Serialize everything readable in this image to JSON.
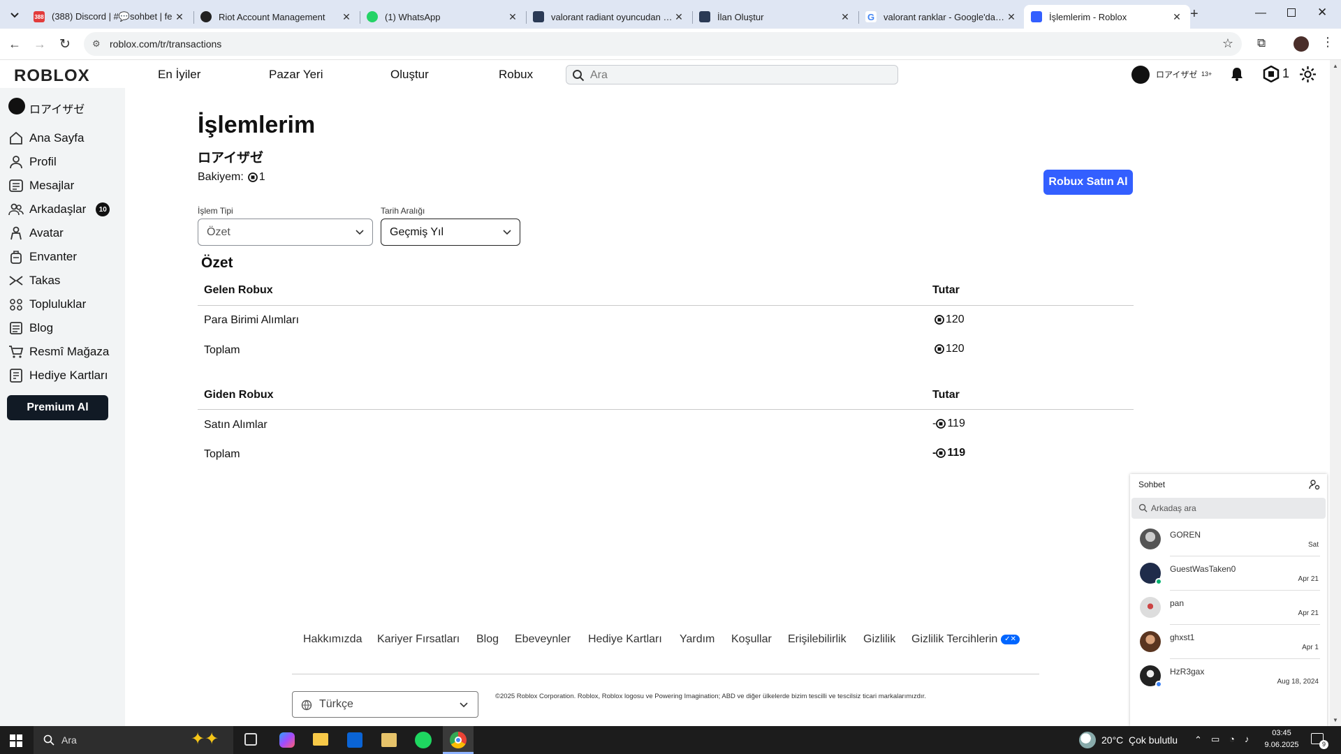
{
  "browser": {
    "tabs": [
      {
        "title": "(388) Discord | #💬sohbet | fe",
        "icon": "discord-icon",
        "badge": "388"
      },
      {
        "title": "Riot Account Management",
        "icon": "riot-icon"
      },
      {
        "title": "(1) WhatsApp",
        "icon": "whatsapp-icon"
      },
      {
        "title": "valorant radiant oyuncudan bo",
        "icon": "roblox-icon"
      },
      {
        "title": "İlan Oluştur",
        "icon": "roblox-icon"
      },
      {
        "title": "valorant ranklar - Google'da Ar",
        "icon": "google-icon"
      },
      {
        "title": "İşlemlerim - Roblox",
        "icon": "roblox-icon",
        "active": true
      }
    ],
    "url": "roblox.com/tr/transactions"
  },
  "header": {
    "logo": "ROBLOX",
    "nav": [
      "En İyiler",
      "Pazar Yeri",
      "Oluştur",
      "Robux"
    ],
    "search_placeholder": "Ara",
    "username": "ロアイザゼ",
    "age_badge": "13+",
    "robux_count": "1"
  },
  "sidebar": {
    "username": "ロアイザゼ",
    "items": [
      {
        "label": "Ana Sayfa",
        "icon": "home-icon"
      },
      {
        "label": "Profil",
        "icon": "profile-icon"
      },
      {
        "label": "Mesajlar",
        "icon": "messages-icon"
      },
      {
        "label": "Arkadaşlar",
        "icon": "friends-icon",
        "badge": "10"
      },
      {
        "label": "Avatar",
        "icon": "avatar-icon"
      },
      {
        "label": "Envanter",
        "icon": "inventory-icon"
      },
      {
        "label": "Takas",
        "icon": "trade-icon"
      },
      {
        "label": "Topluluklar",
        "icon": "communities-icon"
      },
      {
        "label": "Blog",
        "icon": "blog-icon"
      },
      {
        "label": "Resmî Mağaza",
        "icon": "store-icon"
      },
      {
        "label": "Hediye Kartları",
        "icon": "gift-card-icon"
      }
    ],
    "premium_button": "Premium Al"
  },
  "main": {
    "title": "İşlemlerim",
    "username": "ロアイザゼ",
    "balance_label": "Bakiyem:",
    "balance_value": "1",
    "buy_button": "Robux Satın Al",
    "filter_type_label": "İşlem Tipi",
    "filter_type_value": "Özet",
    "filter_date_label": "Tarih Aralığı",
    "filter_date_value": "Geçmiş Yıl",
    "summary_title": "Özet",
    "incoming": {
      "header": "Gelen Robux",
      "amount_header": "Tutar",
      "rows": [
        {
          "label": "Para Birimi Alımları",
          "amount": "120"
        }
      ],
      "total_label": "Toplam",
      "total_amount": "120"
    },
    "outgoing": {
      "header": "Giden Robux",
      "amount_header": "Tutar",
      "rows": [
        {
          "label": "Satın Alımlar",
          "amount": "119"
        }
      ],
      "total_label": "Toplam",
      "total_amount": "119",
      "sign": "-"
    }
  },
  "footer": {
    "links": [
      "Hakkımızda",
      "Kariyer Fırsatları",
      "Blog",
      "Ebeveynler",
      "Hediye Kartları",
      "Yardım",
      "Koşullar",
      "Erişilebilirlik",
      "Gizlilik",
      "Gizlilik Tercihlerin"
    ],
    "language": "Türkçe",
    "copyright": "©2025 Roblox Corporation. Roblox, Roblox logosu ve Powering Imagination; ABD ve diğer ülkelerde bizim tescilli ve tescilsiz ticari markalarımızdır."
  },
  "chat": {
    "title": "Sohbet",
    "search_placeholder": "Arkadaş ara",
    "friends": [
      {
        "name": "GOREN",
        "date": "Sat"
      },
      {
        "name": "GuestWasTaken0",
        "date": "Apr 21",
        "online": true
      },
      {
        "name": "pan",
        "date": "Apr 21"
      },
      {
        "name": "ghxst1",
        "date": "Apr 1"
      },
      {
        "name": "HzR3gax",
        "date": "Aug 18, 2024",
        "online": true
      }
    ]
  },
  "taskbar": {
    "search_placeholder": "Ara",
    "weather_temp": "20°C",
    "weather_desc": "Çok bulutlu",
    "time": "03:45",
    "date": "9.06.2025",
    "notification_count": "9"
  },
  "colors": {
    "accent": "#335fff",
    "premium": "#111a25",
    "taskbar": "#1c1c1c",
    "tabstrip": "#dfe6f3"
  }
}
